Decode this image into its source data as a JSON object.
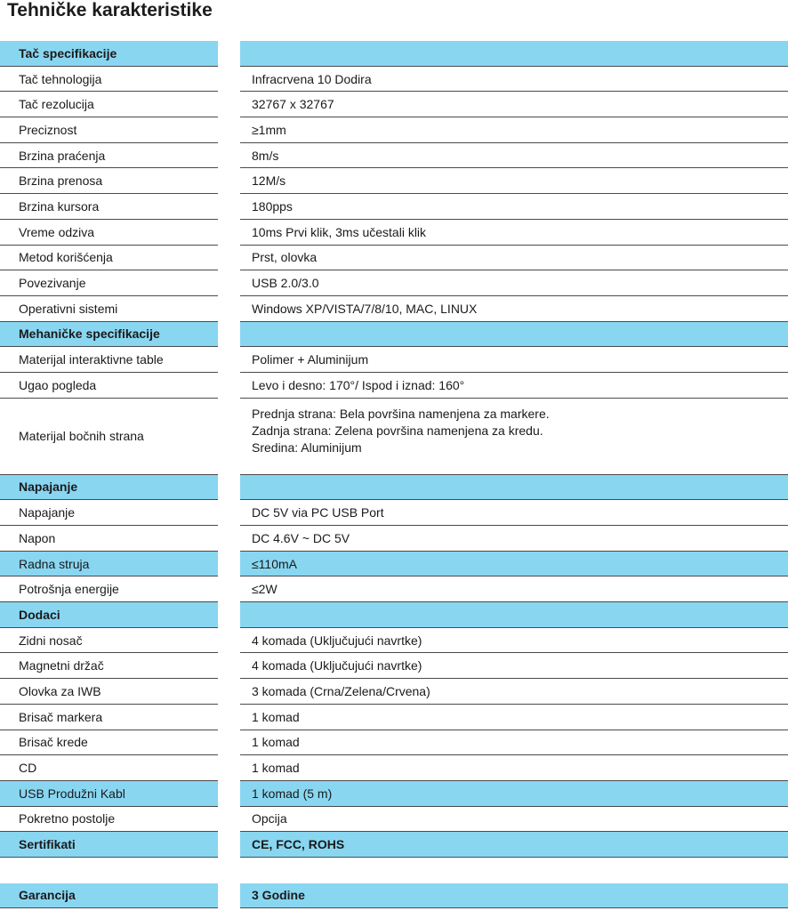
{
  "title": "Tehničke karakteristike",
  "colors": {
    "section_bg": "#89d6f1",
    "rule": "#4a4a4a"
  },
  "rows": [
    {
      "type": "section",
      "label": "Tač specifikacije",
      "value": ""
    },
    {
      "type": "row",
      "label": "Tač tehnologija",
      "value": "Infracrvena 10 Dodira"
    },
    {
      "type": "row",
      "label": "Tač rezolucija",
      "value": "32767 x 32767"
    },
    {
      "type": "row",
      "label": "Preciznost",
      "value": "≥1mm"
    },
    {
      "type": "row",
      "label": "Brzina praćenja",
      "value": "8m/s"
    },
    {
      "type": "row",
      "label": "Brzina prenosa",
      "value": "12M/s"
    },
    {
      "type": "row",
      "label": "Brzina kursora",
      "value": "180pps"
    },
    {
      "type": "row",
      "label": "Vreme odziva",
      "value": "10ms Prvi klik, 3ms učestali klik"
    },
    {
      "type": "row",
      "label": "Metod korišćenja",
      "value": "Prst, olovka"
    },
    {
      "type": "row",
      "label": "Povezivanje",
      "value": "USB 2.0/3.0"
    },
    {
      "type": "row",
      "label": "Operativni sistemi",
      "value": "Windows XP/VISTA/7/8/10, MAC, LINUX"
    },
    {
      "type": "section",
      "label": "Mehaničke specifikacije",
      "value": ""
    },
    {
      "type": "row",
      "label": "Materijal interaktivne table",
      "value": "Polimer + Aluminijum"
    },
    {
      "type": "row",
      "label": "Ugao pogleda",
      "value": "Levo i desno: 170°/ Ispod i iznad: 160°"
    },
    {
      "type": "multi",
      "label": "Materijal bočnih strana",
      "lines": [
        "Prednja strana: Bela površina namenjena za markere.",
        "Zadnja strana: Zelena površina namenjena za kredu.",
        "Sredina: Aluminijum"
      ]
    },
    {
      "type": "section",
      "label": "Napajanje",
      "value": ""
    },
    {
      "type": "row",
      "label": "Napajanje",
      "value": "DC 5V via PC USB Port"
    },
    {
      "type": "row",
      "label": "Napon",
      "value": "DC 4.6V ~ DC 5V"
    },
    {
      "type": "hl",
      "label": "Radna struja",
      "value": "≤110mA"
    },
    {
      "type": "row",
      "label": "Potrošnja energije",
      "value": "≤2W"
    },
    {
      "type": "section",
      "label": "Dodaci",
      "value": ""
    },
    {
      "type": "row",
      "label": "Zidni nosač",
      "value": "4 komada (Uključujući navrtke)"
    },
    {
      "type": "row",
      "label": "Magnetni držač",
      "value": "4 komada (Uključujući navrtke)"
    },
    {
      "type": "row",
      "label": "Olovka za IWB",
      "value": "3 komada (Crna/Zelena/Crvena)"
    },
    {
      "type": "row",
      "label": "Brisač markera",
      "value": "1 komad"
    },
    {
      "type": "row",
      "label": "Brisač krede",
      "value": "1 komad"
    },
    {
      "type": "row",
      "label": "CD",
      "value": "1 komad"
    },
    {
      "type": "hl",
      "label": "USB Produžni Kabl",
      "value": "1 komad (5 m)"
    },
    {
      "type": "row",
      "label": "Pokretno postolje",
      "value": "Opcija"
    },
    {
      "type": "section",
      "label": "Sertifikati",
      "value": "CE, FCC, ROHS"
    },
    {
      "type": "spacer",
      "label": "",
      "value": ""
    },
    {
      "type": "section",
      "label": "Garancija",
      "value": "3 Godine"
    }
  ]
}
